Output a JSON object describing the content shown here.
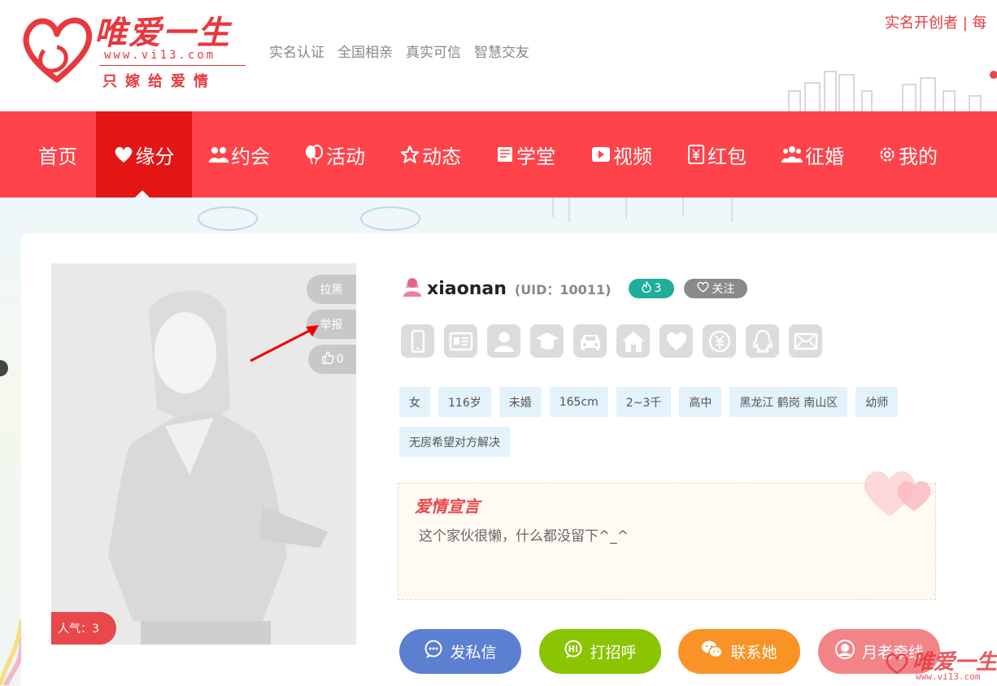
{
  "brand": {
    "name": "唯爱一生",
    "url": "www.vi13.com",
    "slogan": "只嫁给爱情",
    "primary_color": "#ff434a",
    "active_nav_color": "#e41515"
  },
  "header": {
    "taglines": [
      "实名认证",
      "全国相亲",
      "真实可信",
      "智慧交友"
    ],
    "top_right": "实名开创者 | 每"
  },
  "nav": {
    "items": [
      {
        "label": "首页",
        "icon": "none"
      },
      {
        "label": "缘分",
        "icon": "heart-icon"
      },
      {
        "label": "约会",
        "icon": "couple-icon"
      },
      {
        "label": "活动",
        "icon": "balloon-icon"
      },
      {
        "label": "动态",
        "icon": "star-icon"
      },
      {
        "label": "学堂",
        "icon": "book-icon"
      },
      {
        "label": "视频",
        "icon": "video-icon"
      },
      {
        "label": "红包",
        "icon": "red-envelope-icon"
      },
      {
        "label": "征婚",
        "icon": "people-icon"
      },
      {
        "label": "我的",
        "icon": "gear-icon"
      }
    ],
    "active": "缘分"
  },
  "profile": {
    "photo_buttons": {
      "block": "拉黑",
      "report": "举报",
      "likes": "0"
    },
    "popularity": "人气：3",
    "username": "xiaonan",
    "uid": "(UID：10011)",
    "fire_count": "3",
    "follow_label": "关注",
    "verify_icons": [
      "phone-icon",
      "id-card-icon",
      "avatar-icon",
      "education-icon",
      "car-icon",
      "house-icon",
      "marriage-icon",
      "income-icon",
      "qq-icon",
      "email-icon"
    ],
    "tags": [
      "女",
      "116岁",
      "未婚",
      "165cm",
      "2~3千",
      "高中",
      "黑龙江 鹤岗 南山区",
      "幼师",
      "无房希望对方解决"
    ],
    "declaration_title": "爱情宣言",
    "declaration_text": "这个家伙很懒，什么都没留下^_^"
  },
  "actions": [
    {
      "label": "发私信",
      "icon": "chat-icon",
      "color": "#5b7fd1"
    },
    {
      "label": "打招呼",
      "icon": "hi-icon",
      "color": "#8bc400"
    },
    {
      "label": "联系她",
      "icon": "wechat-icon",
      "color": "#f99326"
    },
    {
      "label": "月老牵线",
      "icon": "matchmaker-icon",
      "color": "#f28488"
    }
  ],
  "watermark": {
    "text": "唯爱一生",
    "url": "www.vi13.com"
  }
}
